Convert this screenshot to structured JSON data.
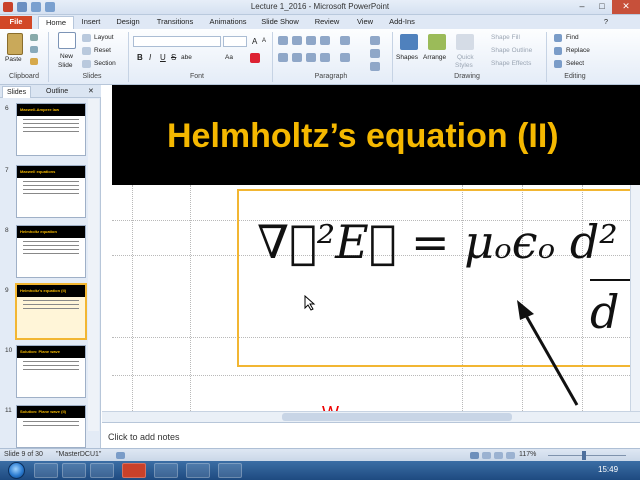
{
  "window": {
    "title": "Lecture 1_2016 - Microsoft PowerPoint",
    "controls": {
      "minimize": "–",
      "maximize": "□",
      "close": "✕"
    }
  },
  "tabs": [
    "File",
    "Home",
    "Insert",
    "Design",
    "Transitions",
    "Animations",
    "Slide Show",
    "Review",
    "View",
    "Add-Ins"
  ],
  "ribbon": {
    "clipboard": {
      "paste": "Paste",
      "label": "Clipboard"
    },
    "slides": {
      "new_slide_line1": "New",
      "new_slide_line2": "Slide",
      "layout": "Layout",
      "reset": "Reset",
      "section": "Section",
      "label": "Slides"
    },
    "font": {
      "label": "Font",
      "bold": "B",
      "italic": "I",
      "underline": "U",
      "strike": "S",
      "shadow": "abe",
      "grow": "A",
      "shrink": "A",
      "case": "Aa"
    },
    "paragraph": {
      "label": "Paragraph"
    },
    "drawing": {
      "shapes": "Shapes",
      "arrange": "Arrange",
      "quick_styles_line1": "Quick",
      "quick_styles_line2": "Styles",
      "shape_fill": "Shape Fill",
      "shape_outline": "Shape Outline",
      "shape_effects": "Shape Effects",
      "label": "Drawing"
    },
    "editing": {
      "find": "Find",
      "replace": "Replace",
      "select": "Select",
      "label": "Editing"
    }
  },
  "panel": {
    "tabs": [
      "Slides",
      "Outline"
    ],
    "close": "✕",
    "thumbnails": [
      {
        "number": "6",
        "title": "Maxwell-Ampere law"
      },
      {
        "number": "7",
        "title": "Maxwell equations"
      },
      {
        "number": "8",
        "title": "Helmholtz equation"
      },
      {
        "number": "9",
        "title": "Helmholtz's equation (II)",
        "selected": true
      },
      {
        "number": "10",
        "title": "Solution: Plane wave"
      },
      {
        "number": "11",
        "title": "Solution: Plane wave (II)"
      }
    ]
  },
  "slide": {
    "title": "Helmholtz’s equation (II)",
    "equation": "∇⃗²E⃗ = μₒϵₒ d²",
    "equation_tail": "d",
    "red_text": "W"
  },
  "notes_placeholder": "Click to add notes",
  "status": {
    "slide": "Slide 9 of 30",
    "theme": "\"MasterDCU1\"",
    "zoom": "117%"
  },
  "taskbar": {
    "clock": "15:49"
  }
}
